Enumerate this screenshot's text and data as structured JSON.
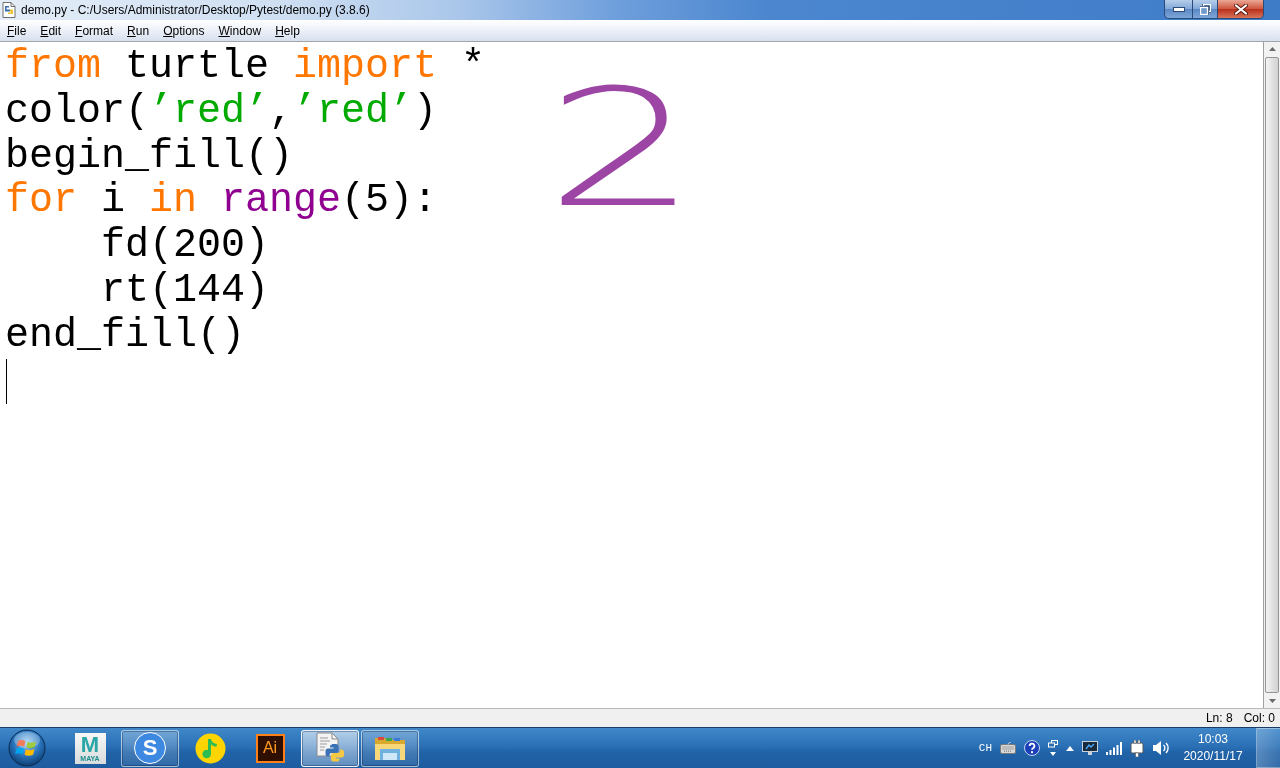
{
  "window": {
    "title": "demo.py - C:/Users/Administrator/Desktop/Pytest/demo.py (3.8.6)"
  },
  "menu_bar": [
    "File",
    "Edit",
    "Format",
    "Run",
    "Options",
    "Window",
    "Help"
  ],
  "editor": {
    "lines": [
      {
        "cursor": false,
        "tokens": [
          {
            "kind": "keyword",
            "text": "from"
          },
          {
            "kind": "plain",
            "text": " turtle "
          },
          {
            "kind": "keyword",
            "text": "import"
          },
          {
            "kind": "plain",
            "text": " *"
          }
        ]
      },
      {
        "cursor": false,
        "tokens": [
          {
            "kind": "plain",
            "text": "color("
          },
          {
            "kind": "string",
            "text": "’red’"
          },
          {
            "kind": "plain",
            "text": ","
          },
          {
            "kind": "string",
            "text": "’red’"
          },
          {
            "kind": "plain",
            "text": ")"
          }
        ]
      },
      {
        "cursor": false,
        "tokens": [
          {
            "kind": "plain",
            "text": "begin_fill()"
          }
        ]
      },
      {
        "cursor": false,
        "tokens": [
          {
            "kind": "keyword",
            "text": "for"
          },
          {
            "kind": "plain",
            "text": " i "
          },
          {
            "kind": "keyword",
            "text": "in "
          },
          {
            "kind": "builtin",
            "text": "range"
          },
          {
            "kind": "plain",
            "text": "(5):"
          }
        ],
        "children": [
          {
            "cursor": false,
            "tokens": [
              {
                "kind": "plain",
                "text": "fd(200)"
              }
            ]
          },
          {
            "cursor": false,
            "tokens": [
              {
                "kind": "plain",
                "text": "rt(144)"
              }
            ]
          }
        ]
      },
      {
        "cursor": false,
        "tokens": [
          {
            "kind": "plain",
            "text": "end_fill()"
          }
        ]
      },
      {
        "cursor": true
      }
    ]
  },
  "handwritten_annotation": "2",
  "status_bar": {
    "line": "Ln: 8",
    "column": "Col: 0"
  },
  "taskbar": {
    "apps": [
      {
        "kind": "maya",
        "running": false,
        "selected": false,
        "logo_text": "M",
        "caption": "MAYA"
      },
      {
        "kind": "browser",
        "running": true,
        "selected": false,
        "logo_text": "S"
      },
      {
        "kind": "music",
        "running": false,
        "selected": false
      },
      {
        "kind": "illustrator",
        "running": false,
        "selected": false,
        "logo_text": "Ai"
      },
      {
        "kind": "python",
        "running": true,
        "selected": true
      },
      {
        "kind": "folder",
        "running": true,
        "selected": false
      }
    ],
    "tray": {
      "language": "CH",
      "time": "10:03",
      "date": "2020/11/17"
    }
  }
}
